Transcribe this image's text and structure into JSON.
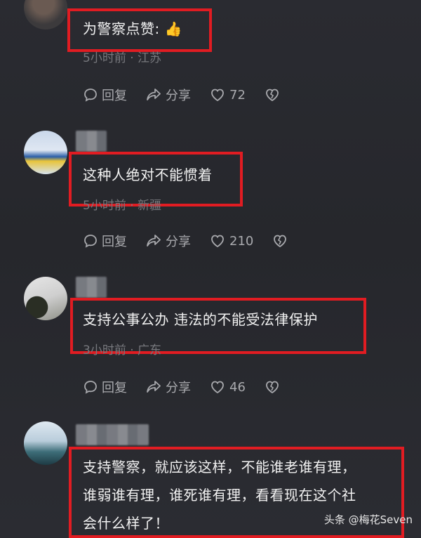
{
  "comments": [
    {
      "text": "为警察点赞: 👍",
      "meta": "5小时前 · 江苏",
      "reply_label": "回复",
      "share_label": "分享",
      "likes": "72"
    },
    {
      "text": "这种人绝对不能惯着",
      "meta": "5小时前 · 新疆",
      "reply_label": "回复",
      "share_label": "分享",
      "likes": "210"
    },
    {
      "text": "支持公事公办  违法的不能受法律保护",
      "meta": "3小时前 · 广东",
      "reply_label": "回复",
      "share_label": "分享",
      "likes": "46"
    },
    {
      "text_lines": [
        "支持警察，就应该这样，不能谁老谁有理，",
        "谁弱谁有理，谁死谁有理，看看现在这个社",
        "会什么样了！"
      ]
    }
  ],
  "watermark": "头条 @梅花Seven",
  "colors": {
    "highlight": "#e11c22",
    "background": "#28292e"
  }
}
